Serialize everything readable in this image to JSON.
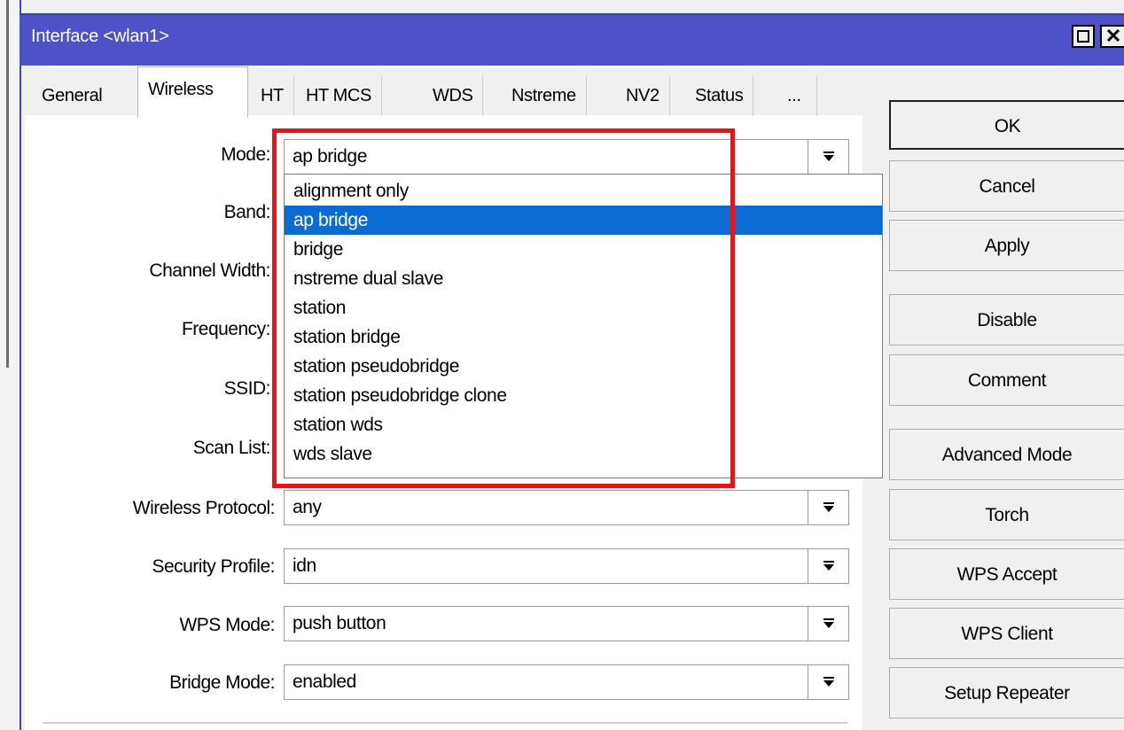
{
  "window": {
    "title": "Interface <wlan1>",
    "title_buttons": [
      "restore",
      "close"
    ]
  },
  "tabs": [
    {
      "label": "General",
      "active": false
    },
    {
      "label": "Wireless",
      "active": true
    },
    {
      "label": "HT",
      "active": false
    },
    {
      "label": "HT MCS",
      "active": false
    },
    {
      "label": "WDS",
      "active": false
    },
    {
      "label": "Nstreme",
      "active": false
    },
    {
      "label": "NV2",
      "active": false
    },
    {
      "label": "Status",
      "active": false
    },
    {
      "label": "...",
      "active": false
    }
  ],
  "form": {
    "mode": {
      "label": "Mode:",
      "value": "ap bridge"
    },
    "band": {
      "label": "Band:"
    },
    "channel_width": {
      "label": "Channel Width:"
    },
    "frequency": {
      "label": "Frequency:"
    },
    "ssid": {
      "label": "SSID:"
    },
    "scan_list": {
      "label": "Scan List:"
    },
    "wireless_protocol": {
      "label": "Wireless Protocol:",
      "value": "any"
    },
    "security_profile": {
      "label": "Security Profile:",
      "value": "idn"
    },
    "wps_mode": {
      "label": "WPS Mode:",
      "value": "push button"
    },
    "bridge_mode": {
      "label": "Bridge Mode:",
      "value": "enabled"
    }
  },
  "mode_dropdown": {
    "open": true,
    "selected": "ap bridge",
    "options": [
      "alignment only",
      "ap bridge",
      "bridge",
      "nstreme dual slave",
      "station",
      "station bridge",
      "station pseudobridge",
      "station pseudobridge clone",
      "station wds",
      "wds slave"
    ]
  },
  "buttons": {
    "ok": "OK",
    "cancel": "Cancel",
    "apply": "Apply",
    "disable": "Disable",
    "comment": "Comment",
    "advanced_mode": "Advanced Mode",
    "torch": "Torch",
    "wps_accept": "WPS Accept",
    "wps_client": "WPS Client",
    "setup_repeater": "Setup Repeater"
  },
  "colors": {
    "title_bar": "#4d53c6",
    "selection": "#0a6cd1",
    "highlight_box": "#e4161a"
  },
  "icons": {
    "dropdown_arrow": "dropdown-arrow-icon"
  }
}
